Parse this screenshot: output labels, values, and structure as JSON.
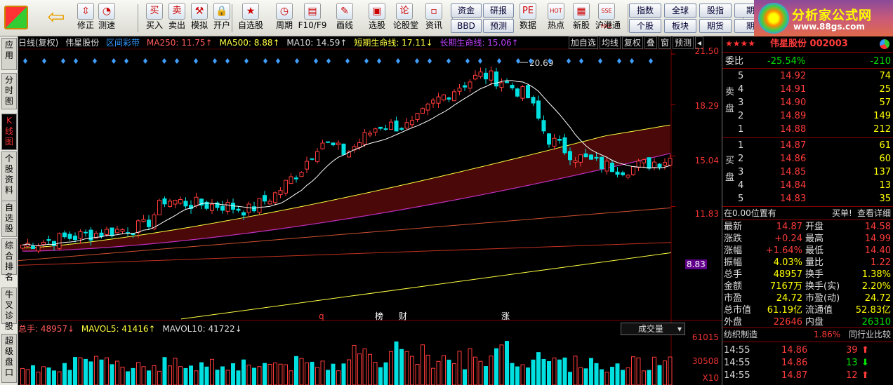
{
  "toolbar": {
    "buttons": [
      {
        "label": "修正",
        "icon": "up-down-arrows-icon"
      },
      {
        "label": "测速",
        "icon": "speed-icon"
      },
      {
        "label": "买入",
        "glyph": "买"
      },
      {
        "label": "卖出",
        "glyph": "卖"
      },
      {
        "label": "模拟",
        "icon": "hammer-icon"
      },
      {
        "label": "开户",
        "icon": "lock-icon"
      },
      {
        "label": "自选股",
        "icon": "star-folder-icon"
      },
      {
        "label": "周期",
        "icon": "clock-icon"
      },
      {
        "label": "F10/F9",
        "icon": "f10-icon"
      },
      {
        "label": "画线",
        "icon": "pencil-icon"
      },
      {
        "label": "选股",
        "icon": "screen-icon"
      },
      {
        "label": "论股堂",
        "glyph": "论"
      },
      {
        "label": "资讯"
      },
      {
        "label": "数据",
        "glyph": "PE"
      },
      {
        "label": "热点",
        "glyph": "HOT"
      },
      {
        "label": "新股",
        "icon": "new-stock-icon"
      },
      {
        "label": "沪港通",
        "glyph": "SSE HKE"
      }
    ],
    "small": [
      "资金",
      "研报",
      "BBD",
      "预测"
    ],
    "right": [
      "指数",
      "全球",
      "股指",
      "期",
      "个股",
      "板块",
      "期货",
      "期"
    ],
    "logo_title": "分析家公式网",
    "logo_url": "www.88gs.com"
  },
  "left_tabs": [
    "应用",
    "分时图",
    "K线图",
    "个股资料",
    "自选股",
    "综合排名",
    "牛叉诊股",
    "超级盘口"
  ],
  "header": {
    "period": "日线(复权)",
    "name": "伟星股份",
    "band": "区间彩带",
    "ma250": "MA250: 11.75↑",
    "ma500": "MA500: 8.88↑",
    "ma10": "MA10: 14.59↑",
    "short": "短期生命线: 17.11↓",
    "long": "长期生命线: 15.06↑",
    "buttons": [
      "加自选",
      "均线",
      "复权",
      "叠",
      "窗",
      "预测"
    ]
  },
  "price_axis": [
    "21.50",
    "18.29",
    "15.04",
    "11.83",
    "8.83"
  ],
  "peak_label": "20.69",
  "events": [
    "q",
    "榜",
    "财",
    "涨"
  ],
  "volume": {
    "total": "总手: 48957↓",
    "mavol5": "MAVOL5: 41416↑",
    "mavol10": "MAVOL10: 41722↓",
    "selector": "成交量",
    "axis": [
      "61015",
      "30508",
      "X10"
    ]
  },
  "colors": {
    "up": "#ff3b3b",
    "down": "#00e0e0",
    "ma10": "#ffffff",
    "band": "#4a0808",
    "yellow": "#ffff40",
    "purple": "#c030c0"
  },
  "quote": {
    "stars": "★★★★",
    "title": "伟星股份 002003",
    "weibi_label": "委比",
    "weibi": "-25.54%",
    "weicha": "-210",
    "sell_label": "卖盘",
    "buy_label": "买盘",
    "sell": [
      [
        "5",
        "14.92",
        "74"
      ],
      [
        "4",
        "14.91",
        "25"
      ],
      [
        "3",
        "14.90",
        "57"
      ],
      [
        "2",
        "14.89",
        "149"
      ],
      [
        "1",
        "14.88",
        "212"
      ]
    ],
    "buy": [
      [
        "1",
        "14.87",
        "61"
      ],
      [
        "2",
        "14.86",
        "60"
      ],
      [
        "3",
        "14.85",
        "137"
      ],
      [
        "4",
        "14.84",
        "13"
      ],
      [
        "5",
        "14.83",
        "35"
      ]
    ],
    "position": "在0.00位置有",
    "buy1": "买单!",
    "detail": "查看详细",
    "stats": [
      [
        "最新",
        "14.87",
        "开盘",
        "14.58"
      ],
      [
        "涨跌",
        "+0.24",
        "最高",
        "14.99"
      ],
      [
        "涨幅",
        "+1.64%",
        "最低",
        "14.40"
      ],
      [
        "振幅",
        "4.03%",
        "量比",
        "1.22"
      ],
      [
        "总手",
        "48957",
        "换手",
        "1.38%"
      ],
      [
        "金额",
        "7167万",
        "换手(实)",
        "2.20%"
      ],
      [
        "市盈",
        "24.72",
        "市盈(动)",
        "24.72"
      ],
      [
        "总市值",
        "61.19亿",
        "流通值",
        "52.83亿"
      ],
      [
        "外盘",
        "22646",
        "内盘",
        "26310"
      ]
    ],
    "industry": "纺织制造",
    "industry_pct": "1.86%",
    "compare": "同行业比较",
    "ticks": [
      [
        "14:55",
        "14.86",
        "39"
      ],
      [
        "14:55",
        "14.86",
        "13"
      ],
      [
        "14:55",
        "14.87",
        "12"
      ]
    ]
  }
}
